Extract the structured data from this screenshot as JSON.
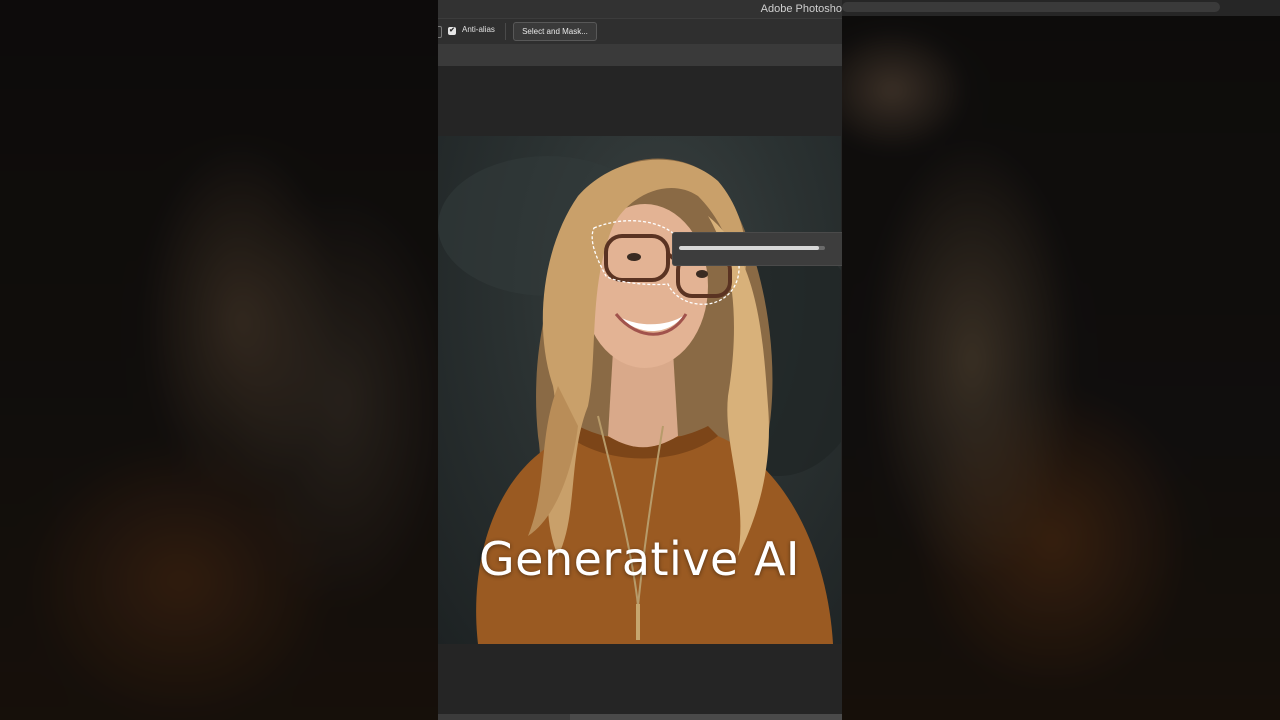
{
  "app": {
    "window_title": "Adobe Photosho"
  },
  "options_bar": {
    "anti_alias_label": "Anti-alias",
    "anti_alias_checked": true,
    "select_and_mask_label": "Select and Mask..."
  },
  "canvas": {
    "caption": "Generative AI"
  },
  "generation_progress": {
    "fraction": 0.96
  },
  "icons": {
    "checkbox_check": "✔"
  },
  "colors": {
    "panel_bg": "#2b2b2b",
    "canvas_bg": "#252525",
    "sweater": "#9a5a22",
    "hair": "#c9a06a"
  }
}
